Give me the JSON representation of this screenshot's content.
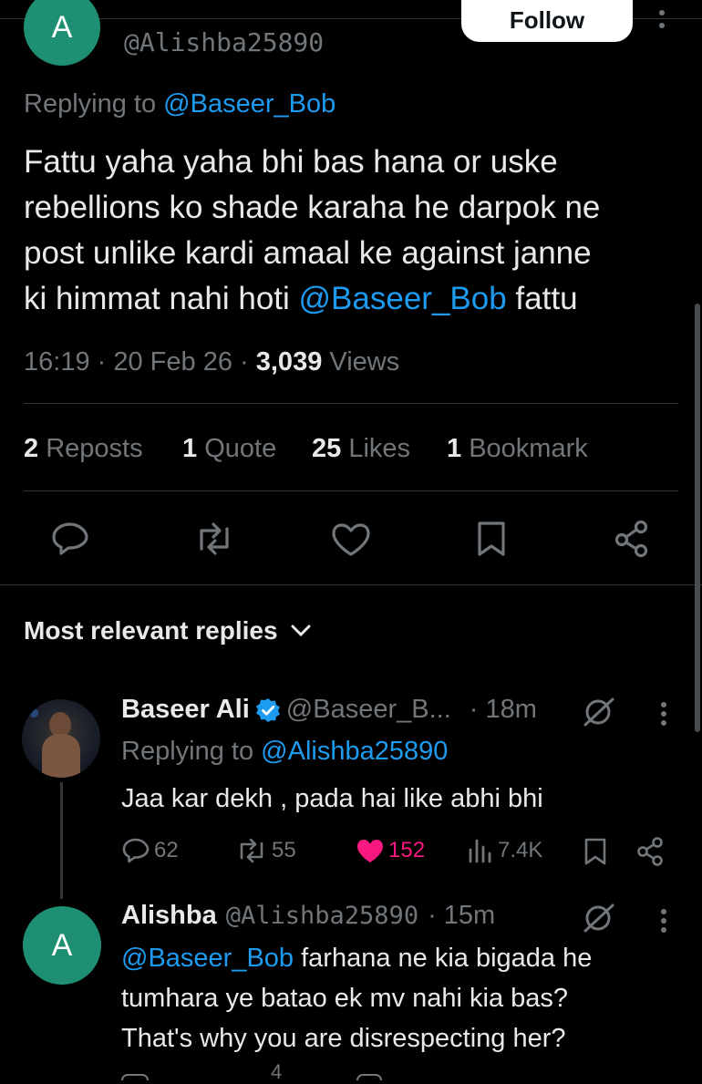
{
  "header": {
    "handle": "@Alishba25890",
    "follow_label": "Follow",
    "avatar_letter": "A"
  },
  "tweet": {
    "replying_prefix": "Replying to ",
    "replying_to": "@Baseer_Bob",
    "text_parts": {
      "line1": "Fattu yaha yaha bhi bas hana or uske",
      "line2": "rebellions ko shade karaha he darpok ne",
      "line3": "post unlike kardi amaal ke against janne",
      "line4_prefix": "ki himmat nahi hoti ",
      "line4_mention": "@Baseer_Bob",
      "line4_suffix": " fattu"
    },
    "time": "16:19",
    "date": "20 Feb 26",
    "views_count": "3,039",
    "views_label": "Views",
    "stats": {
      "reposts_count": "2",
      "reposts_label": "Reposts",
      "quotes_count": "1",
      "quotes_label": "Quote",
      "likes_count": "25",
      "likes_label": "Likes",
      "bookmarks_count": "1",
      "bookmarks_label": "Bookmark"
    }
  },
  "sort": {
    "label": "Most relevant replies"
  },
  "replies": [
    {
      "name": "Baseer Ali",
      "handle": "@Baseer_B...",
      "time": "· 18m",
      "replying_prefix": "Replying to ",
      "replying_to": "@Alishba25890",
      "text": "Jaa kar dekh , pada hai like abhi bhi",
      "replies_count": "62",
      "reposts_count": "55",
      "likes_count": "152",
      "views_count": "7.4K"
    },
    {
      "name": "Alishba",
      "handle": "@Alishba25890",
      "time": "· 15m",
      "avatar_letter": "A",
      "mention": "@Baseer_Bob",
      "line1_rest": " farhana ne kia bigada he",
      "line2": "tumhara ye batao ek mv nahi kia bas?",
      "line3": "That's why you are disrespecting her?",
      "partial_count": "4"
    }
  ],
  "colors": {
    "background": "#000000",
    "accent": "#1d9bf0",
    "like": "#f91880",
    "avatar": "#1e8f73"
  }
}
